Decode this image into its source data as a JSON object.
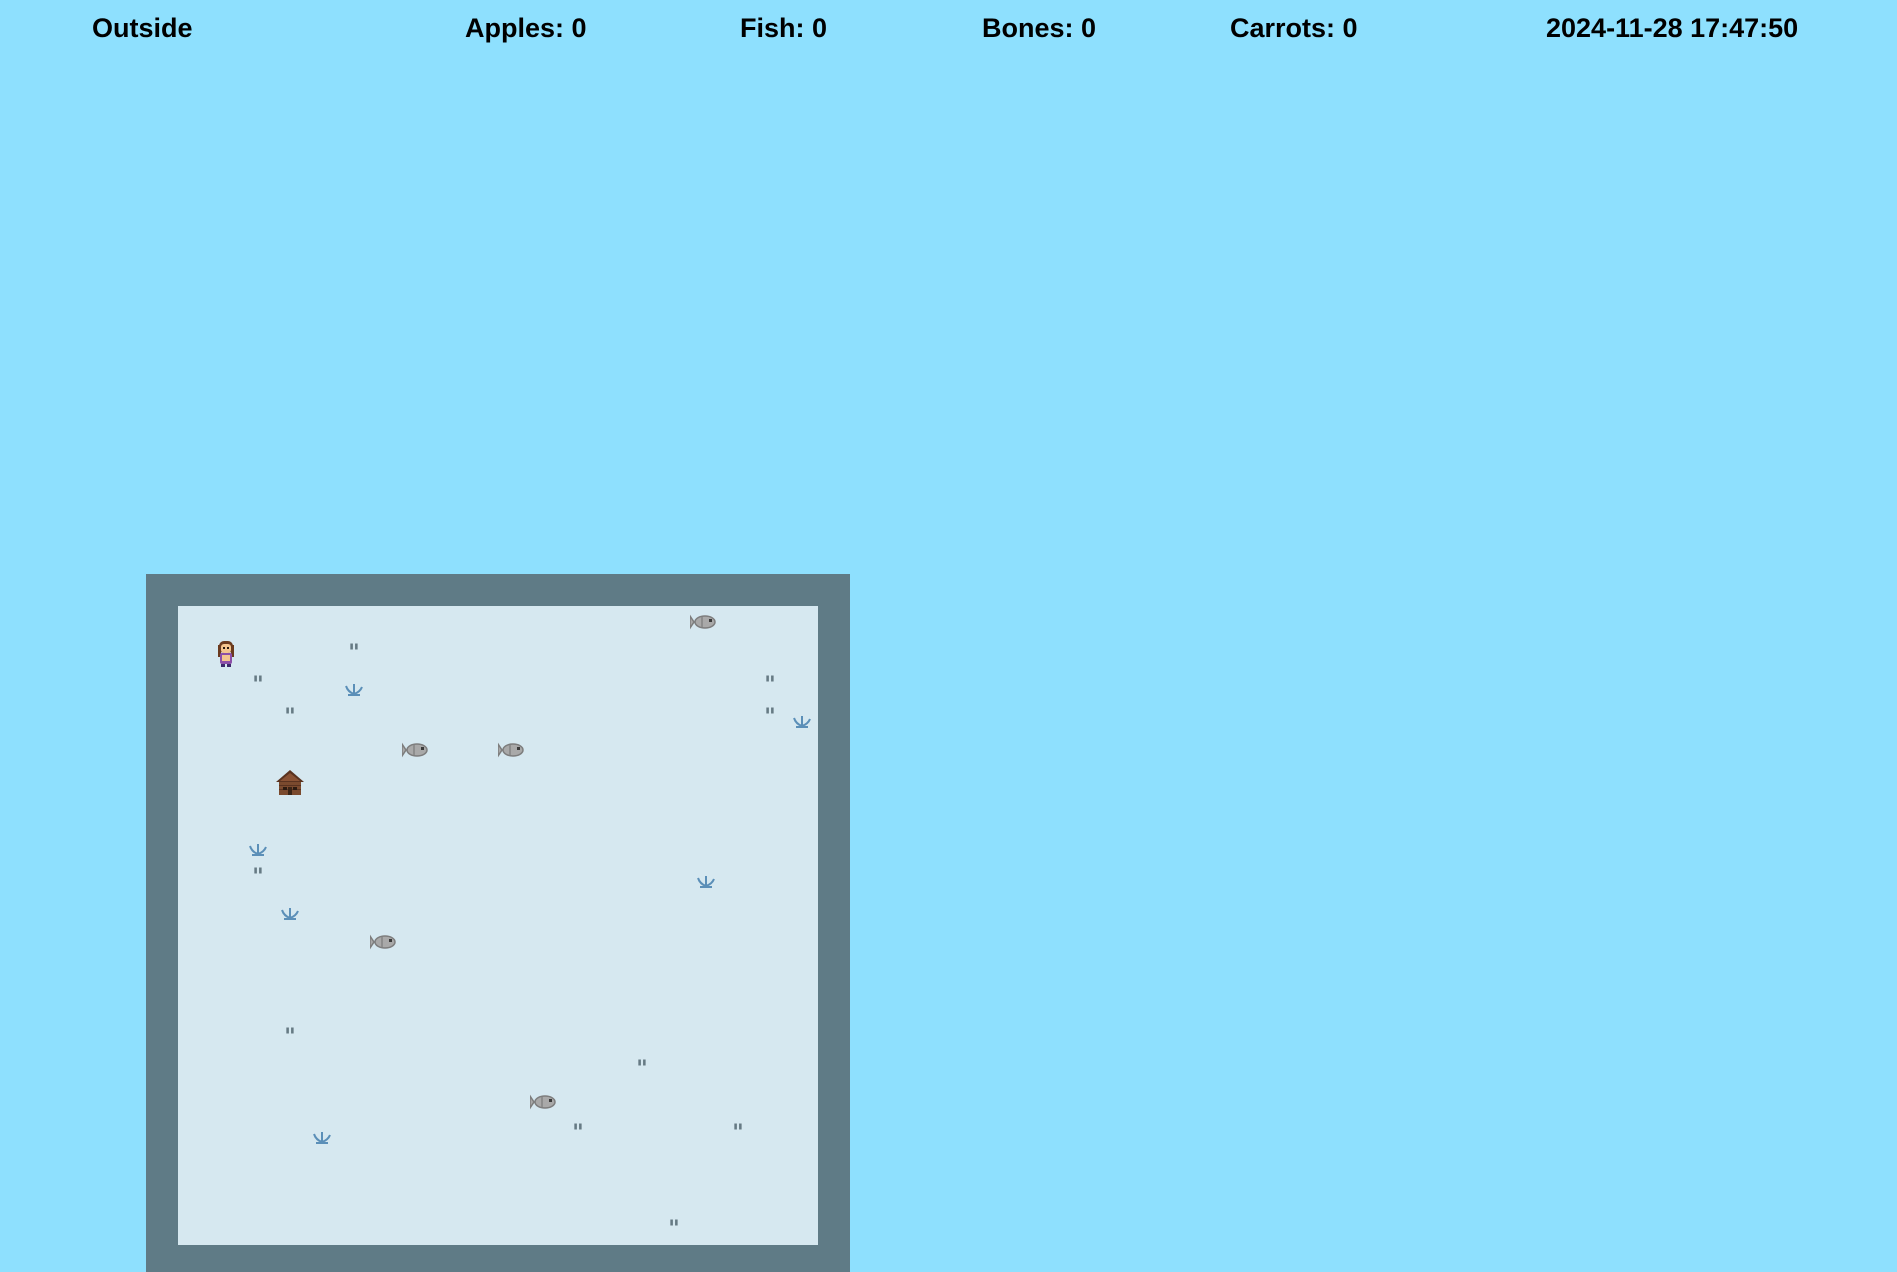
{
  "hud": {
    "location": "Outside",
    "apples": "Apples: 0",
    "fish": "Fish: 0",
    "bones": "Bones: 0",
    "carrots": "Carrots: 0",
    "datetime": "2024-11-28 17:47:50"
  },
  "colors": {
    "sky": "#8ee0fe",
    "wall": "#5f7b86",
    "floor": "#d6e8f0",
    "tuft": "#667a84",
    "sprout": "#5b8fb8",
    "fish": "#a9a9a9",
    "cabin": "#7a4a2e"
  },
  "map": {
    "player": {
      "icon": "player-girl-icon"
    },
    "house": {
      "icon": "cabin-icon"
    },
    "fish_icon": "fish-icon",
    "sprout_icon": "sprout-icon",
    "tuft_icon": "grass-tuft-icon"
  }
}
